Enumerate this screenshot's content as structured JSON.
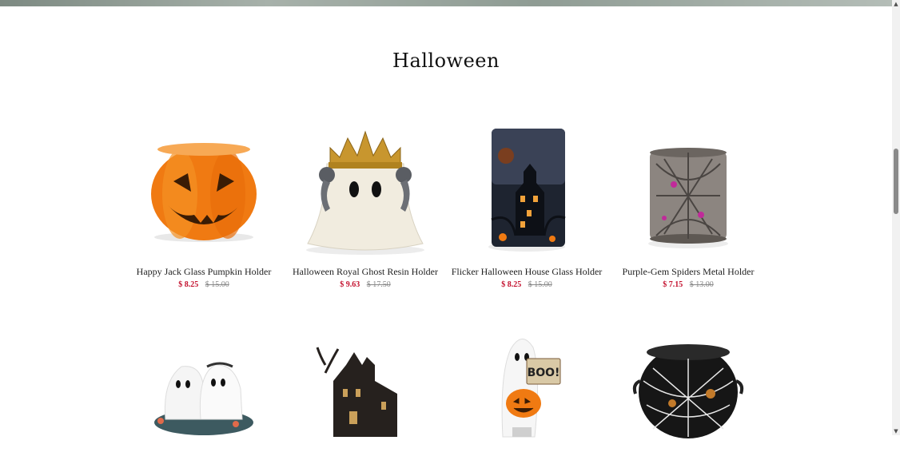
{
  "section": {
    "title": "Halloween"
  },
  "scrollbar": {
    "up": "▲",
    "down": "▼"
  },
  "products": [
    {
      "name": "Happy Jack Glass Pumpkin Holder",
      "sale_price": "$ 8.25",
      "original_price": "$ 15.00",
      "icon": "pumpkin-holder"
    },
    {
      "name": "Halloween Royal Ghost Resin Holder",
      "sale_price": "$ 9.63",
      "original_price": "$ 17.50",
      "icon": "royal-ghost-holder"
    },
    {
      "name": "Flicker Halloween House Glass Holder",
      "sale_price": "$ 8.25",
      "original_price": "$ 15.00",
      "icon": "haunted-house-glass-holder"
    },
    {
      "name": "Purple-Gem Spiders Metal Holder",
      "sale_price": "$ 7.15",
      "original_price": "$ 13.00",
      "icon": "spider-metal-holder"
    },
    {
      "icon": "twin-ghosts-holder"
    },
    {
      "icon": "haunted-house-figure"
    },
    {
      "icon": "boo-ghost-holder"
    },
    {
      "icon": "spiderweb-cauldron-holder"
    }
  ]
}
